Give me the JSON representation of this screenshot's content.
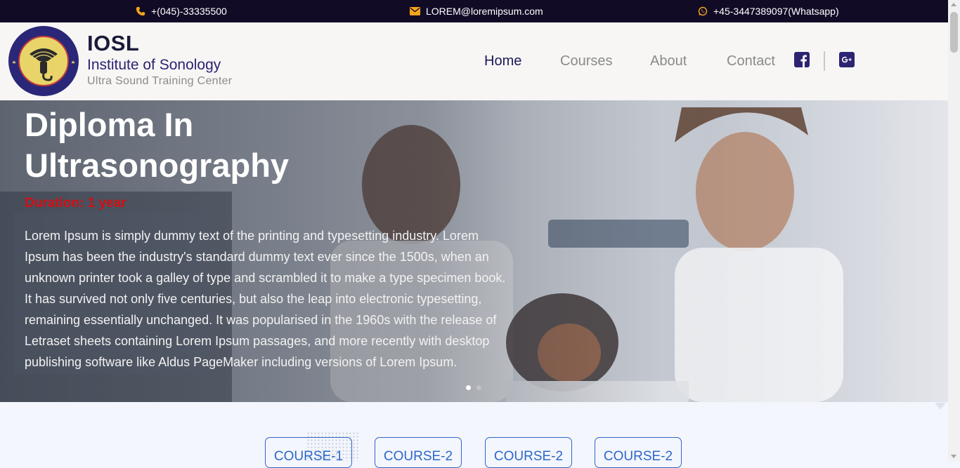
{
  "topbar": {
    "phone": "+(045)-33335500",
    "email": "LOREM@loremipsum.com",
    "whatsapp": "+45-3447389097(Whatsapp)",
    "icon_color": "#f2a51a"
  },
  "brand": {
    "name": "IOSL",
    "subtitle": "Institute of Sonology",
    "tagline": "Ultra Sound Training Center",
    "seal_text": "Institute of Sonology",
    "seal_abbr": "IOSL"
  },
  "nav": {
    "items": [
      "Home",
      "Courses",
      "About",
      "Contact"
    ],
    "active": "Home",
    "social": [
      "facebook-icon",
      "google-plus-icon"
    ]
  },
  "hero": {
    "title": "Diploma In Ultrasonography",
    "duration": "Duration: 1 year",
    "text": "Lorem Ipsum is simply dummy text of the printing and typesetting industry. Lorem Ipsum has been the industry's standard dummy text ever since the 1500s, when an unknown printer took a galley of type and scrambled it to make a type specimen book. It has survived not only five centuries, but also the leap into electronic typesetting, remaining essentially unchanged. It was popularised in the 1960s with the release of Letraset sheets containing Lorem Ipsum passages, and more recently with desktop publishing software like Aldus PageMaker including versions of Lorem Ipsum.",
    "slides": 2,
    "active_slide": 1
  },
  "courses": {
    "buttons": [
      "COURSE-1",
      "COURSE-2",
      "COURSE-2",
      "COURSE-2"
    ]
  },
  "colors": {
    "topbar_bg": "#120b26",
    "accent_blue": "#2c67c9",
    "duration_red": "#d20f14",
    "nav_active": "#1c1a55"
  }
}
